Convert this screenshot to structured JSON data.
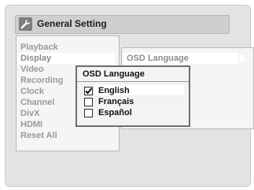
{
  "header": {
    "title": "General Setting",
    "icon": "wrench-icon"
  },
  "left_menu": {
    "items": [
      {
        "label": "Playback"
      },
      {
        "label": "Display",
        "selected": true
      },
      {
        "label": "Video"
      },
      {
        "label": "Recording"
      },
      {
        "label": "Clock"
      },
      {
        "label": "Channel"
      },
      {
        "label": "DivX"
      },
      {
        "label": "HDMI"
      },
      {
        "label": "Reset All"
      }
    ]
  },
  "right_panel": {
    "selected_label": "OSD Language"
  },
  "popup": {
    "title": "OSD Language",
    "options": [
      {
        "label": "English",
        "checked": true
      },
      {
        "label": "Français",
        "checked": false
      },
      {
        "label": "Español",
        "checked": false
      }
    ]
  },
  "colors": {
    "screen_bg": "#e3e3e3",
    "panel_bg": "#f5f5f5",
    "menu_text": "#9a9a9a",
    "popup_border": "#6e6e6e"
  }
}
